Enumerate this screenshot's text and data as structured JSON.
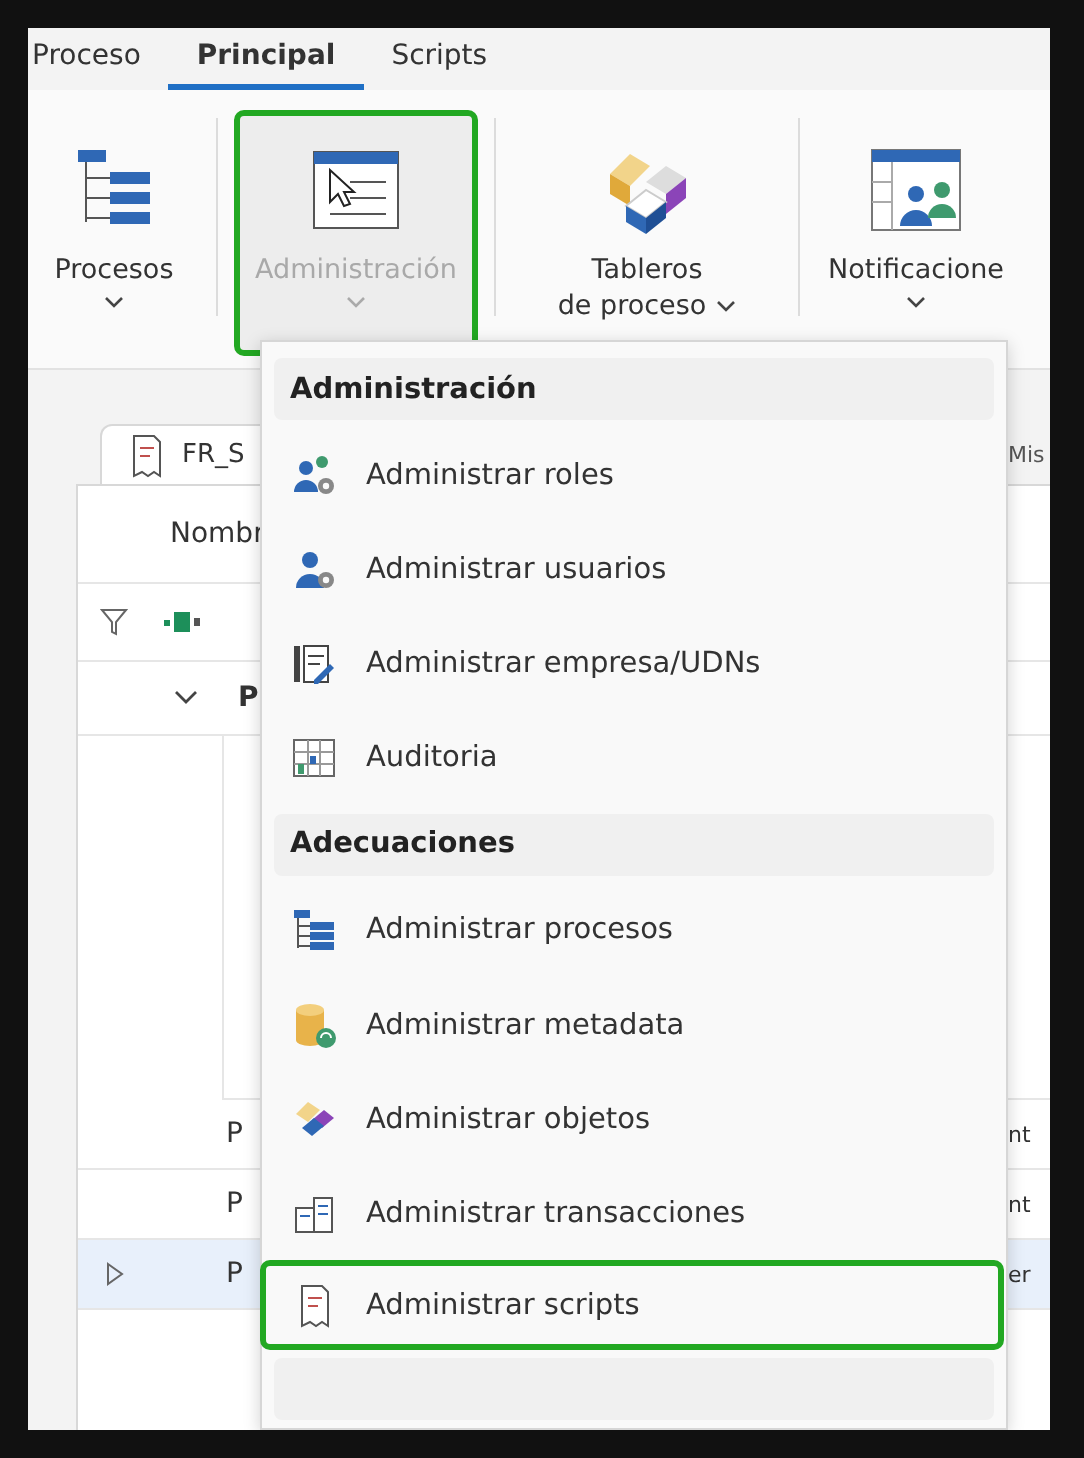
{
  "ribbon_tabs": [
    {
      "label": "Proceso",
      "selected": false
    },
    {
      "label": "Principal",
      "selected": true
    },
    {
      "label": "Scripts",
      "selected": false
    }
  ],
  "ribbon_buttons": [
    {
      "kind": "tree",
      "lines": [
        "Procesos"
      ],
      "selected": false,
      "disabled": false
    },
    {
      "kind": "admin",
      "lines": [
        "Administración"
      ],
      "selected": true,
      "disabled": true
    },
    {
      "kind": "blocks",
      "lines": [
        "Tableros",
        "de proceso"
      ],
      "selected": false,
      "disabled": false
    },
    {
      "kind": "notify",
      "lines": [
        "Notificacione"
      ],
      "selected": false,
      "disabled": false
    }
  ],
  "document_tabs": [
    {
      "label": "FR_S"
    },
    {
      "label": "Mis"
    }
  ],
  "table": {
    "header": "Nombr",
    "group": "P",
    "rows": [
      {
        "name": "P",
        "tail": "nt",
        "selected": false
      },
      {
        "name": "P",
        "tail": "nt",
        "selected": false
      },
      {
        "name": "P",
        "tail": "er",
        "selected": true
      }
    ]
  },
  "menu": {
    "sections": [
      {
        "title": "Administración",
        "items": [
          {
            "kind": "roles",
            "label": "Administrar roles",
            "selected": false
          },
          {
            "kind": "users",
            "label": "Administrar usuarios",
            "selected": false
          },
          {
            "kind": "company",
            "label": "Administrar empresa/UDNs",
            "selected": false
          },
          {
            "kind": "audit",
            "label": "Auditoria",
            "selected": false
          }
        ]
      },
      {
        "title": "Adecuaciones",
        "items": [
          {
            "kind": "tree",
            "label": "Administrar procesos",
            "selected": false
          },
          {
            "kind": "metadata",
            "label": "Administrar metadata",
            "selected": false
          },
          {
            "kind": "blocks",
            "label": "Administrar objetos",
            "selected": false
          },
          {
            "kind": "transactions",
            "label": "Administrar transacciones",
            "selected": false
          },
          {
            "kind": "script",
            "label": "Administrar scripts",
            "selected": true
          }
        ]
      }
    ]
  }
}
